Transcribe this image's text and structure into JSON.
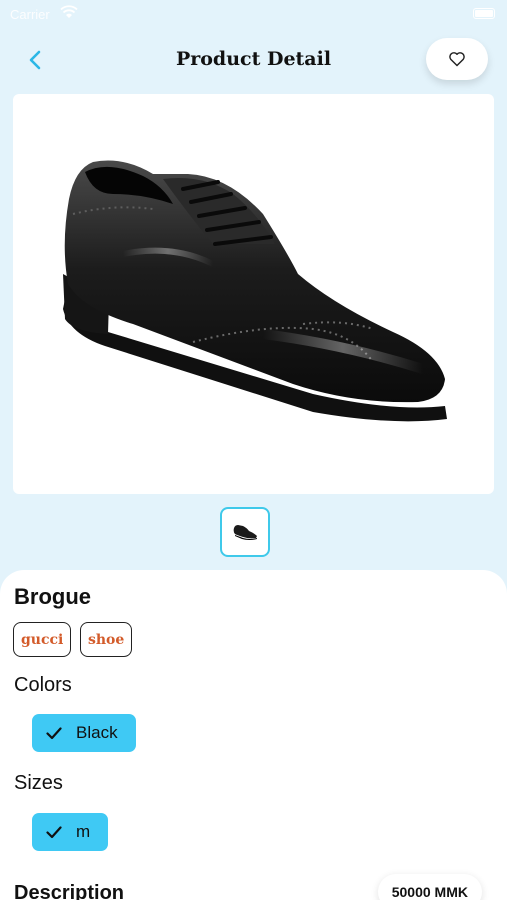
{
  "status_bar": {
    "carrier": "Carrier",
    "time": ""
  },
  "header": {
    "title": "Product Detail",
    "back_icon": "chevron-left-icon",
    "favorite_icon": "heart-outline-icon"
  },
  "product": {
    "name": "Brogue",
    "tags": [
      "gucci",
      "shoe"
    ],
    "colors_label": "Colors",
    "colors": [
      {
        "label": "Black",
        "selected": true
      }
    ],
    "sizes_label": "Sizes",
    "sizes": [
      {
        "label": "m",
        "selected": true
      }
    ],
    "description_label": "Description",
    "price": "50000 MMK"
  },
  "theme": {
    "background": "#e3f3fb",
    "accent": "#3fc9f4",
    "tag_text": "#d35b2a",
    "back_icon": "#2bb7e6"
  }
}
